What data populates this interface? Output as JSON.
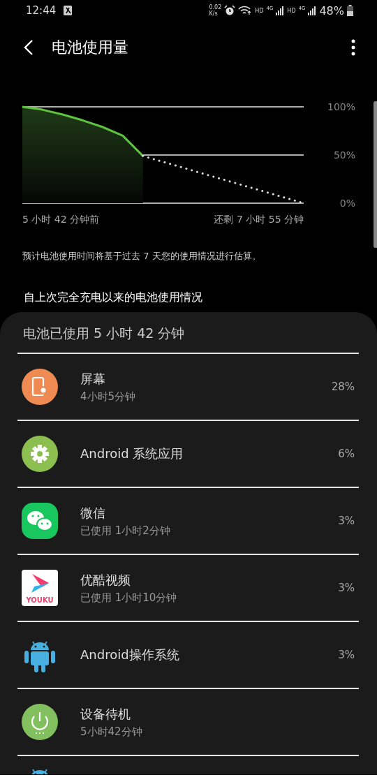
{
  "status_bar": {
    "time": "12:44",
    "speed_value": "0.02",
    "speed_unit": "K/s",
    "network_1": "HD",
    "network_1_type": "4G",
    "network_2": "HD",
    "network_2_type": "4G",
    "battery": "48%"
  },
  "header": {
    "title": "电池使用量"
  },
  "chart": {
    "start_label": "5 小时 42 分钟前",
    "end_label": "还剩 7 小时 55 分钟",
    "chart_data": {
      "type": "line",
      "categories": [
        null,
        null,
        null,
        null,
        null,
        null,
        null,
        null,
        null,
        null,
        null,
        null,
        null,
        null,
        null
      ],
      "series": [
        {
          "color": "#5fc33f",
          "line_style": "solid",
          "values": [
            100,
            97,
            92,
            86,
            79,
            70,
            49,
            null,
            null,
            null,
            null,
            null,
            null,
            null,
            null
          ]
        },
        {
          "color": "#d8d8d8",
          "line_style": "dotted",
          "values": [
            null,
            null,
            null,
            null,
            null,
            null,
            49,
            42.9,
            36.8,
            30.6,
            24.5,
            18.4,
            12.3,
            6.1,
            0
          ]
        }
      ],
      "ylim": [
        0,
        100
      ],
      "yticks": [
        {
          "value": 100,
          "label": "100%"
        },
        {
          "value": 50,
          "label": "50%"
        },
        {
          "value": 0,
          "label": "0%"
        }
      ]
    }
  },
  "note": "预计电池使用时间将基于过去 7 天您的使用情况进行估算。",
  "section_title": "自上次完全充电以来的电池使用情况",
  "usage": {
    "title": "电池已使用 5 小时 42 分钟",
    "rows": [
      {
        "kind": "screen",
        "name": "屏幕",
        "detail": "4小时5分钟",
        "percent": "28%"
      },
      {
        "kind": "system",
        "name": "Android 系统应用",
        "percent": "6%"
      },
      {
        "kind": "chat",
        "name": "微信",
        "detail": "已使用 1小时2分钟",
        "percent": "3%"
      },
      {
        "kind": "video",
        "name": "优酷视频",
        "detail": "已使用 1小时10分钟",
        "percent": "3%",
        "logo_text": "YOUKU"
      },
      {
        "kind": "android",
        "name": "Android操作系统",
        "percent": "3%"
      },
      {
        "kind": "standby",
        "name": "设备待机",
        "detail": "5小时42分钟"
      },
      {
        "kind": "android"
      }
    ]
  }
}
